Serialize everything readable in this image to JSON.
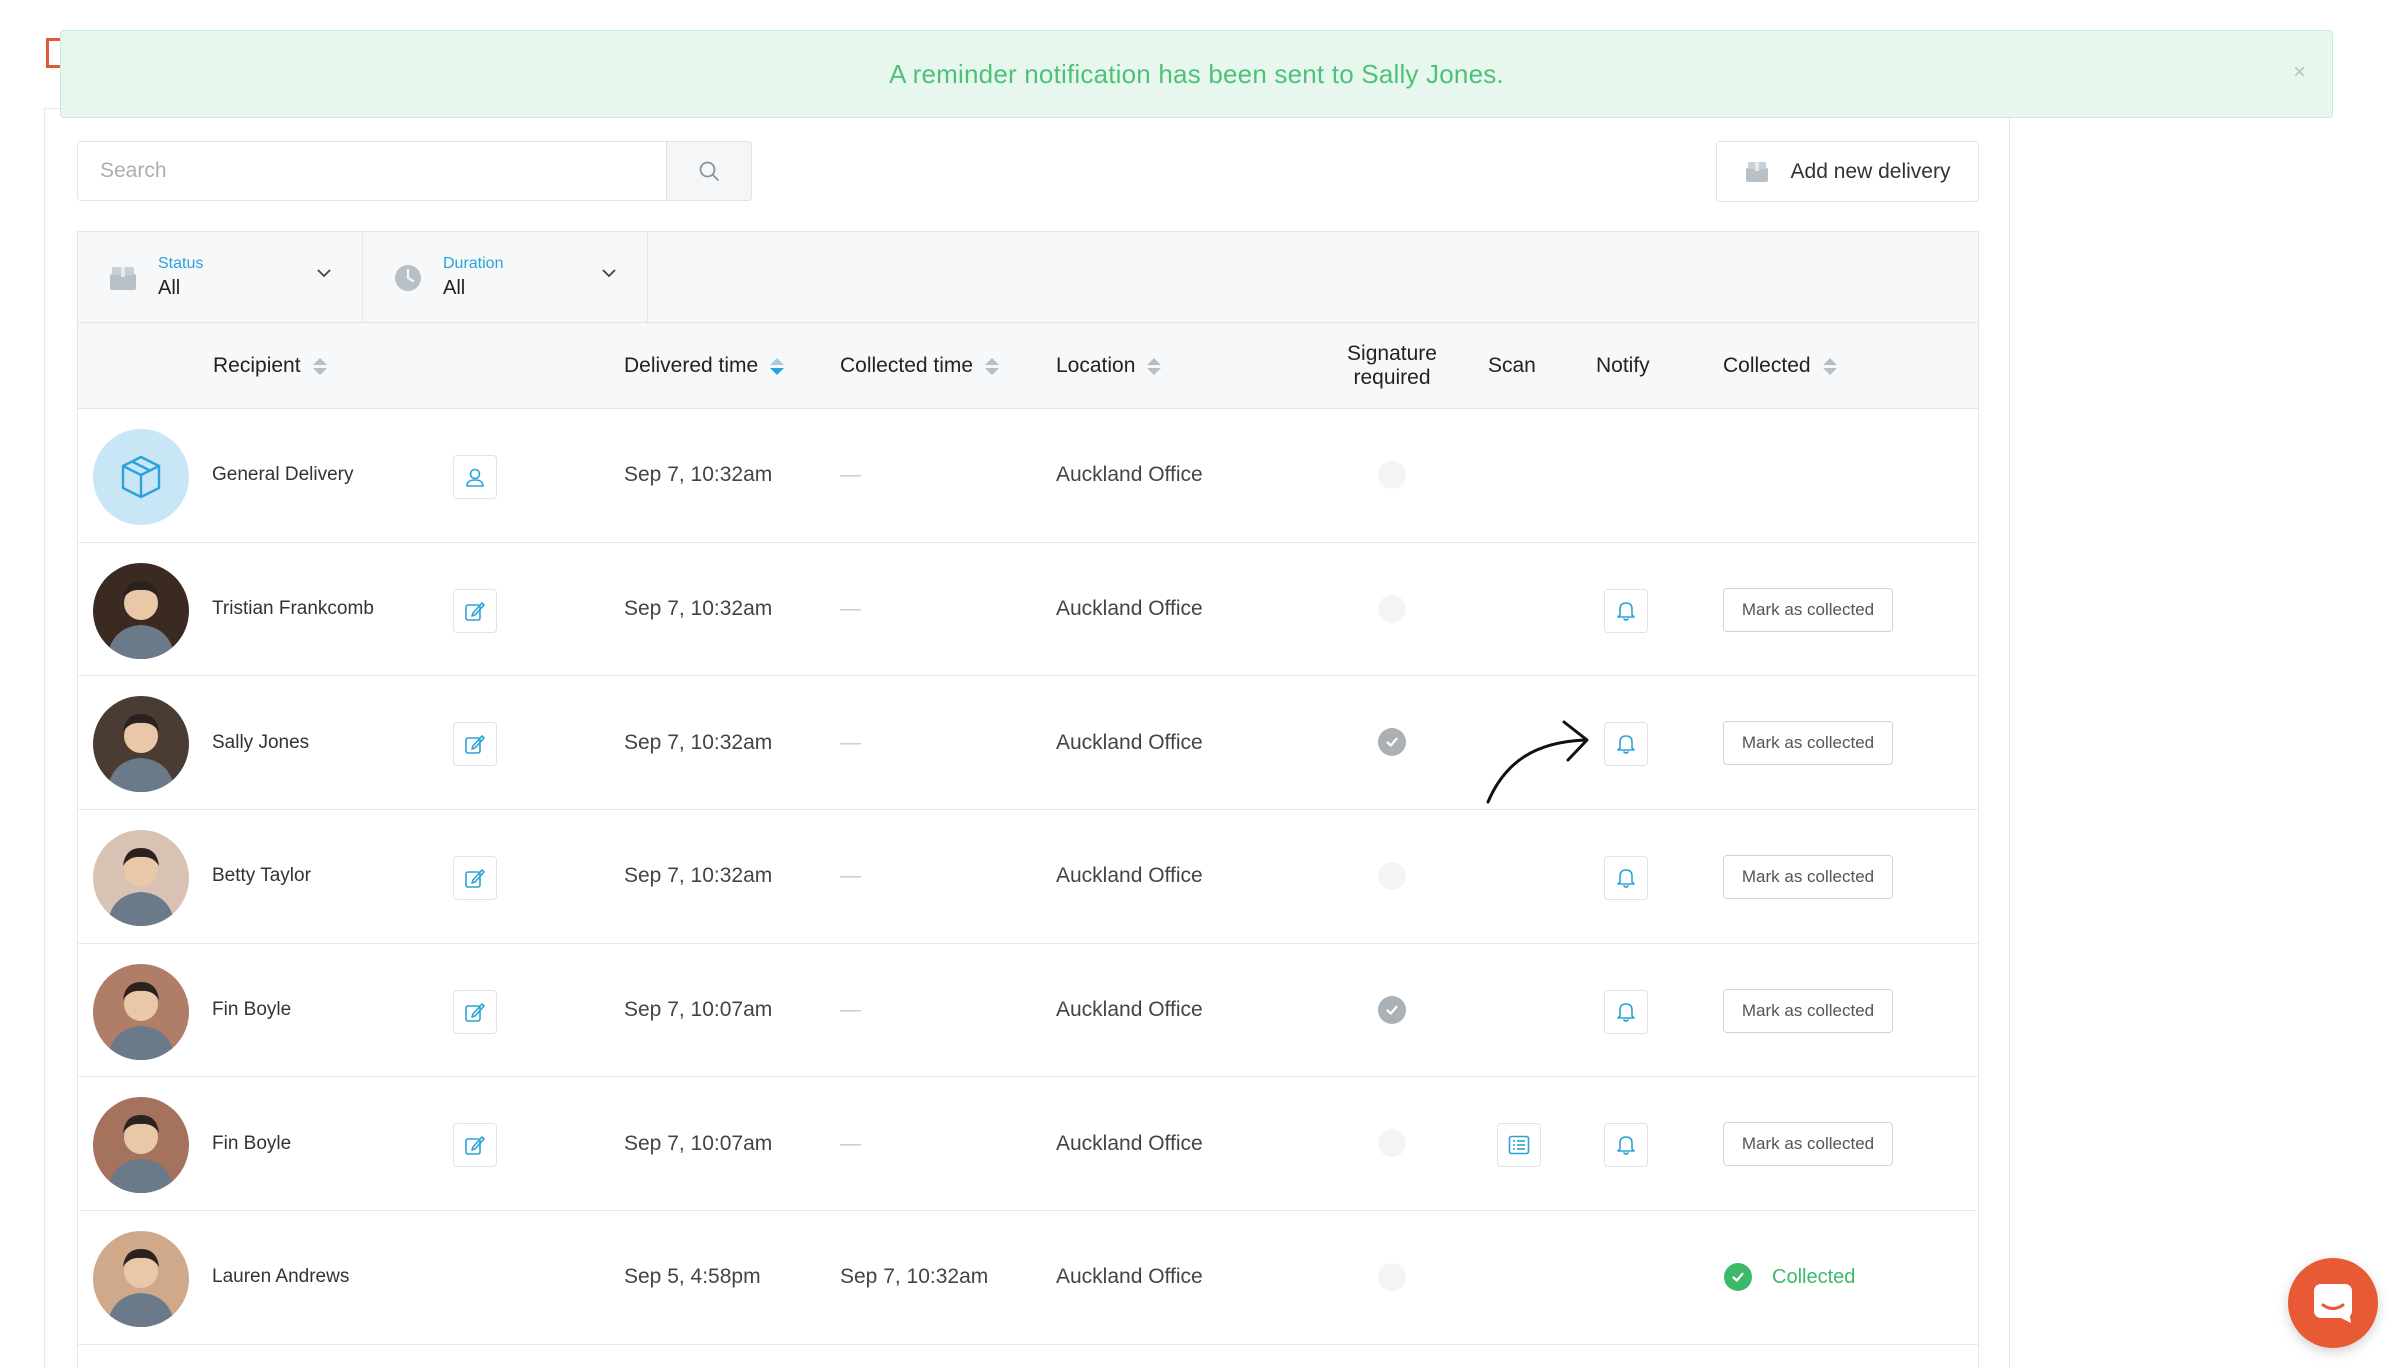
{
  "toast": {
    "message": "A reminder notification has been sent to Sally Jones.",
    "close": "×"
  },
  "search": {
    "placeholder": "Search",
    "value": ""
  },
  "toolbar": {
    "add_label": "Add new delivery"
  },
  "filters": [
    {
      "label": "Status",
      "value": "All",
      "icon": "package-icon"
    },
    {
      "label": "Duration",
      "value": "All",
      "icon": "clock-icon"
    }
  ],
  "columns": {
    "recipient": "Recipient",
    "delivered": "Delivered time",
    "collected_time": "Collected time",
    "location": "Location",
    "signature_1": "Signature",
    "signature_2": "required",
    "scan": "Scan",
    "notify": "Notify",
    "collected": "Collected"
  },
  "rows": [
    {
      "name": "General Delivery",
      "delivered": "Sep 7, 10:32am",
      "collected_time": "—",
      "location": "Auckland Office",
      "signature": false,
      "scan": false,
      "notify": false,
      "status": "none",
      "action": "user"
    },
    {
      "name": "Tristian Frankcomb",
      "delivered": "Sep 7, 10:32am",
      "collected_time": "—",
      "location": "Auckland Office",
      "signature": false,
      "scan": false,
      "notify": true,
      "status": "pending",
      "action": "edit"
    },
    {
      "name": "Sally Jones",
      "delivered": "Sep 7, 10:32am",
      "collected_time": "—",
      "location": "Auckland Office",
      "signature": true,
      "scan": false,
      "notify": true,
      "status": "pending",
      "action": "edit"
    },
    {
      "name": "Betty Taylor",
      "delivered": "Sep 7, 10:32am",
      "collected_time": "—",
      "location": "Auckland Office",
      "signature": false,
      "scan": false,
      "notify": true,
      "status": "pending",
      "action": "edit"
    },
    {
      "name": "Fin Boyle",
      "delivered": "Sep 7, 10:07am",
      "collected_time": "—",
      "location": "Auckland Office",
      "signature": true,
      "scan": false,
      "notify": true,
      "status": "pending",
      "action": "edit"
    },
    {
      "name": "Fin Boyle",
      "delivered": "Sep 7, 10:07am",
      "collected_time": "—",
      "location": "Auckland Office",
      "signature": false,
      "scan": true,
      "notify": true,
      "status": "pending",
      "action": "edit"
    },
    {
      "name": "Lauren Andrews",
      "delivered": "Sep 5, 4:58pm",
      "collected_time": "Sep 7, 10:32am",
      "location": "Auckland Office",
      "signature": false,
      "scan": false,
      "notify": false,
      "status": "collected",
      "action": "none"
    }
  ],
  "labels": {
    "mark_collected": "Mark as collected",
    "collected": "Collected"
  },
  "colors": {
    "accent": "#2ba3d8",
    "success": "#3cb96b",
    "toast_bg": "#e8f7ee",
    "chat": "#e85a36"
  },
  "avatars": [
    "#c8e6f5",
    "#3a2a22",
    "#4a3b33",
    "#d8c2b3",
    "#b07d68",
    "#a4725d",
    "#cfa98a"
  ]
}
